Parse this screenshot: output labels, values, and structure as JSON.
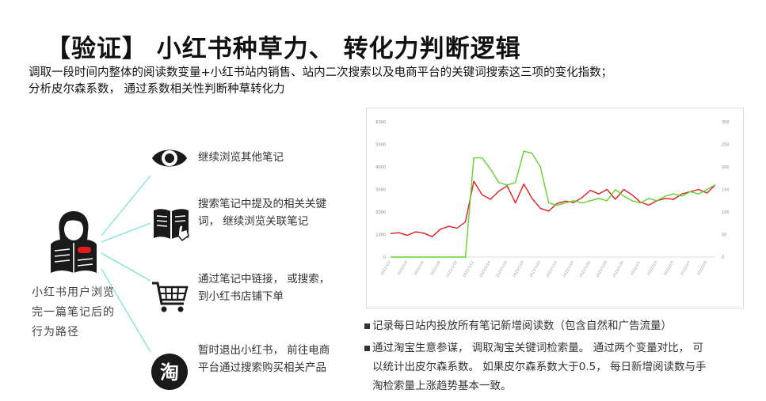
{
  "title": "【验证】 小红书种草力、 转化力判断逻辑",
  "subtitle": "调取一段时间内整体的阅读数变量+小红书站内销售、站内二次搜索以及电商平台的关键词搜索这三项的变化指数；\n分析皮尔森系数， 通过系数相关性判断种草转化力",
  "user": {
    "icon": "reading-user-icon",
    "caption": "小红书用户浏览完一篇笔记后的行为路径"
  },
  "steps": [
    {
      "icon": "eye-icon",
      "text": "继续浏览其他笔记"
    },
    {
      "icon": "book-search-icon",
      "text": "搜索笔记中提及的相关关键\n词， 继续浏览关联笔记"
    },
    {
      "icon": "shopping-cart-icon",
      "text": "通过笔记中链接， 或搜索，\n到小红书店铺下单"
    },
    {
      "icon": "taobao-icon",
      "text": "暂时退出小红书， 前往电商\n平台通过搜索购买相关产品"
    }
  ],
  "colors": {
    "connector": "#7fe3d8",
    "red_series": "#e11d1d",
    "green_series": "#5fd42e",
    "icon_dark": "#1a1a1a"
  },
  "notes": [
    "记录每日站内投放所有笔记新增阅读数（包含自然和广告流量）",
    "通过淘宝生意参谋， 调取淘宝关键词检索量。 通过两个变量对比， 可\n以统计出皮尔森系数。 如果皮尔森系数大于0.5， 每日新增阅读数与手\n淘检索量上涨趋势基本一致。"
  ],
  "chart_data": {
    "type": "line",
    "left_axis": {
      "ticks": [
        "0",
        "1000",
        "2000",
        "3000",
        "4000",
        "5000",
        "6000"
      ],
      "ylim": [
        0,
        6000
      ]
    },
    "right_axis": {
      "ticks": [
        "0",
        "50",
        "100",
        "150",
        "200",
        "250",
        "300"
      ],
      "ylim": [
        0,
        300
      ]
    },
    "categories": [
      "2022/1/2",
      "2022/1/3",
      "2022/1/4",
      "2022/1/5",
      "2022/1/6",
      "2022/1/7",
      "2022/1/8",
      "2022/1/9",
      "2022/1/10",
      "2022/1/11",
      "2022/1/12",
      "2022/1/13",
      "2022/1/14",
      "2022/1/15",
      "2022/1/16",
      "2022/1/17",
      "2022/1/18",
      "2022/1/19",
      "2022/1/20",
      "2022/1/21",
      "2022/1/22",
      "2022/1/23",
      "2022/1/24",
      "2022/1/25",
      "2022/1/26",
      "2022/1/27",
      "2022/1/28",
      "2022/1/29",
      "2022/1/30",
      "2022/1/31",
      "2022/2/1",
      "2022/2/2",
      "2022/2/3",
      "2022/2/4",
      "2022/2/5",
      "2022/2/6",
      "2022/2/7",
      "2022/2/8",
      "2022/2/9",
      "2022/2/10"
    ],
    "series": [
      {
        "color": "red",
        "axis": "right",
        "values": [
          52,
          54,
          48,
          56,
          53,
          45,
          62,
          68,
          64,
          78,
          168,
          138,
          128,
          146,
          158,
          120,
          162,
          130,
          108,
          102,
          119,
          124,
          121,
          132,
          148,
          140,
          150,
          128,
          150,
          138,
          122,
          115,
          125,
          130,
          128,
          140,
          145,
          150,
          142,
          160
        ]
      },
      {
        "color": "green",
        "axis": "left",
        "values": [
          0,
          0,
          0,
          0,
          0,
          0,
          0,
          0,
          0,
          0,
          4400,
          4400,
          3900,
          3300,
          3200,
          3300,
          4700,
          4600,
          4000,
          2400,
          2300,
          2400,
          2500,
          2400,
          2500,
          2600,
          2500,
          3000,
          2700,
          2500,
          2400,
          2600,
          2500,
          2700,
          2800,
          2700,
          2900,
          2800,
          3000,
          3200
        ]
      }
    ],
    "grid": false
  }
}
